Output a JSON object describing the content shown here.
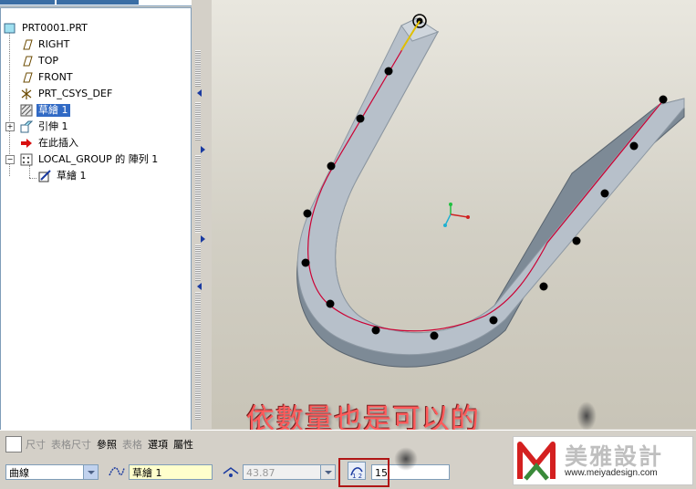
{
  "model_tree": {
    "items": [
      {
        "label": "PRT0001.PRT",
        "icon": "part-icon"
      },
      {
        "label": "RIGHT",
        "icon": "datum-plane-icon"
      },
      {
        "label": "TOP",
        "icon": "datum-plane-icon"
      },
      {
        "label": "FRONT",
        "icon": "datum-plane-icon"
      },
      {
        "label": "PRT_CSYS_DEF",
        "icon": "coordinate-system-icon"
      },
      {
        "label": "草繪 1",
        "icon": "sketch-icon",
        "selected": true
      },
      {
        "label": "引伸 1",
        "icon": "extrude-icon"
      },
      {
        "label": "在此插入",
        "icon": "insert-here-arrow-icon"
      },
      {
        "label": "LOCAL_GROUP 的 陣列 1",
        "icon": "pattern-icon"
      },
      {
        "label": "草繪 1",
        "icon": "sketch-icon"
      }
    ]
  },
  "overlay_caption": "依數量也是可以的",
  "dashboard": {
    "tabs": [
      {
        "label": "尺寸",
        "enabled": false
      },
      {
        "label": "表格尺寸",
        "enabled": false
      },
      {
        "label": "參照",
        "enabled": true
      },
      {
        "label": "表格",
        "enabled": false
      },
      {
        "label": "選項",
        "enabled": true
      },
      {
        "label": "屬性",
        "enabled": true
      }
    ],
    "pattern_type": "曲線",
    "reference_curve": "草繪 1",
    "spacing_value": "43.87",
    "member_count": "15"
  },
  "watermark": {
    "brand": "美雅設計",
    "url": "www.meiyadesign.com"
  },
  "colors": {
    "selection": "#316ac5",
    "curve": "#cc0033",
    "body": "#aab4bf",
    "caption": "#ff5a5a"
  }
}
